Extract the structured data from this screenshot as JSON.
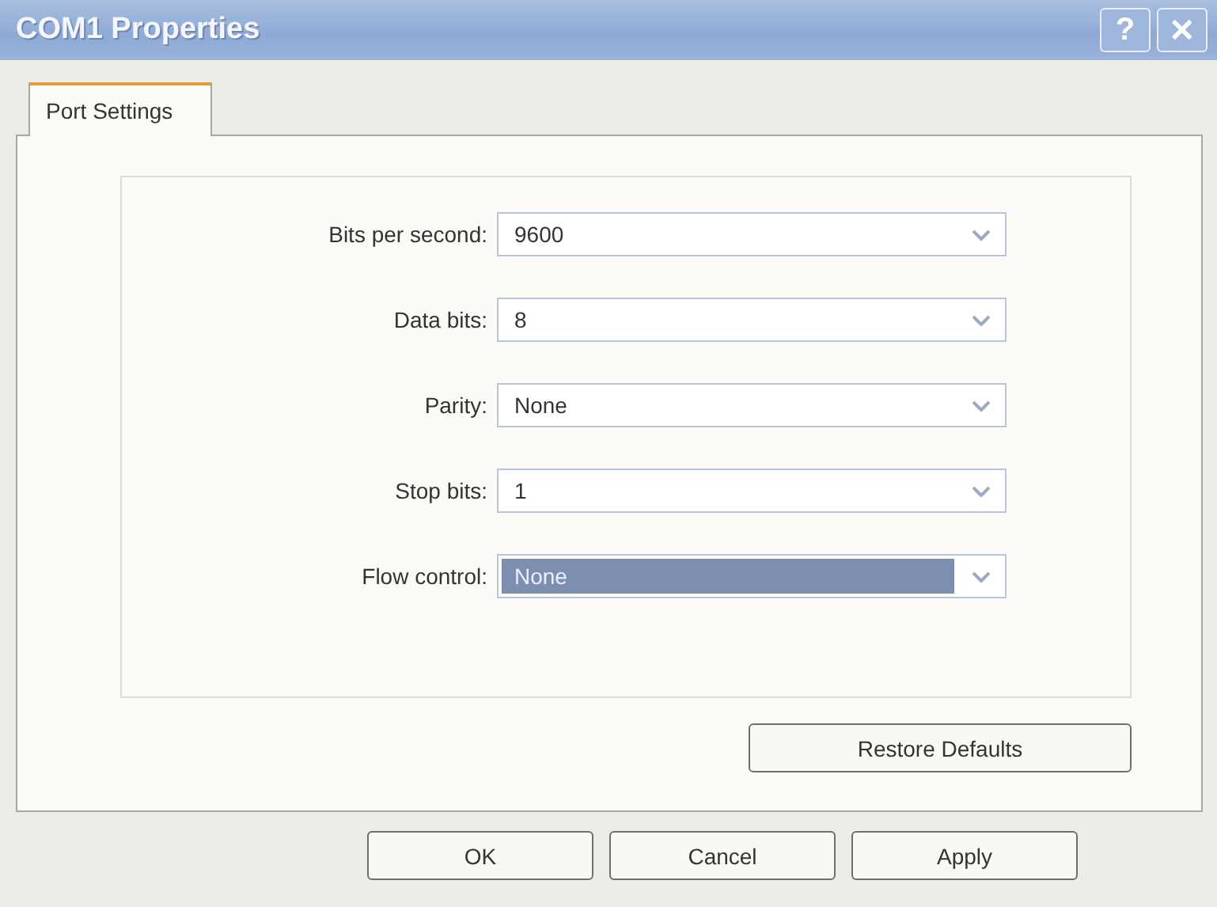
{
  "window": {
    "title": "COM1 Properties",
    "title_buttons": [
      "?",
      "✕"
    ]
  },
  "tabs": [
    {
      "label": "Port Settings",
      "selected": true
    }
  ],
  "fields": [
    {
      "label": "Bits per second:",
      "value": "9600",
      "selected": false
    },
    {
      "label": "Data bits:",
      "value": "8",
      "selected": false
    },
    {
      "label": "Parity:",
      "value": "None",
      "selected": false
    },
    {
      "label": "Stop bits:",
      "value": "1",
      "selected": false
    },
    {
      "label": "Flow control:",
      "value": "None",
      "selected": true
    }
  ],
  "restore_button": "Restore Defaults",
  "buttons": [
    "OK",
    "Cancel",
    "Apply"
  ]
}
